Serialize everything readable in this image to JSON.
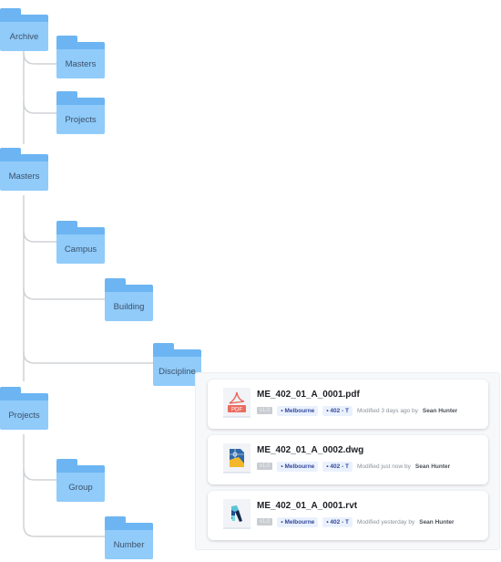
{
  "tree": {
    "groups": [
      {
        "parent": "Archive",
        "children": [
          "Masters",
          "Projects"
        ]
      },
      {
        "parent": "Masters",
        "children": [
          "Campus",
          "Building",
          "Discipline"
        ]
      },
      {
        "parent": "Projects",
        "children": [
          "Group",
          "Number"
        ]
      }
    ]
  },
  "files": {
    "items": [
      {
        "name": "ME_402_01_A_0001.pdf",
        "icon": "pdf-file-icon",
        "version": "v1.0",
        "location": "Melbourne",
        "code": "402 - T",
        "modified": "Modified 3 days ago by",
        "user": "Sean Hunter"
      },
      {
        "name": "ME_402_01_A_0002.dwg",
        "icon": "dwg-file-icon",
        "version": "v1.0",
        "location": "Melbourne",
        "code": "402 - T",
        "modified": "Modified just now by",
        "user": "Sean Hunter"
      },
      {
        "name": "ME_402_01_A_0001.rvt",
        "icon": "rvt-file-icon",
        "version": "v1.0",
        "location": "Melbourne",
        "code": "402 - T",
        "modified": "Modified yesterday by",
        "user": "Sean Hunter"
      }
    ]
  },
  "colors": {
    "folder_tab": "#6cb5f2",
    "folder_body": "#90cbfa",
    "connector": "#cfd2d6",
    "tag_bg": "#eaf1fe",
    "tag_text": "#33499a"
  }
}
